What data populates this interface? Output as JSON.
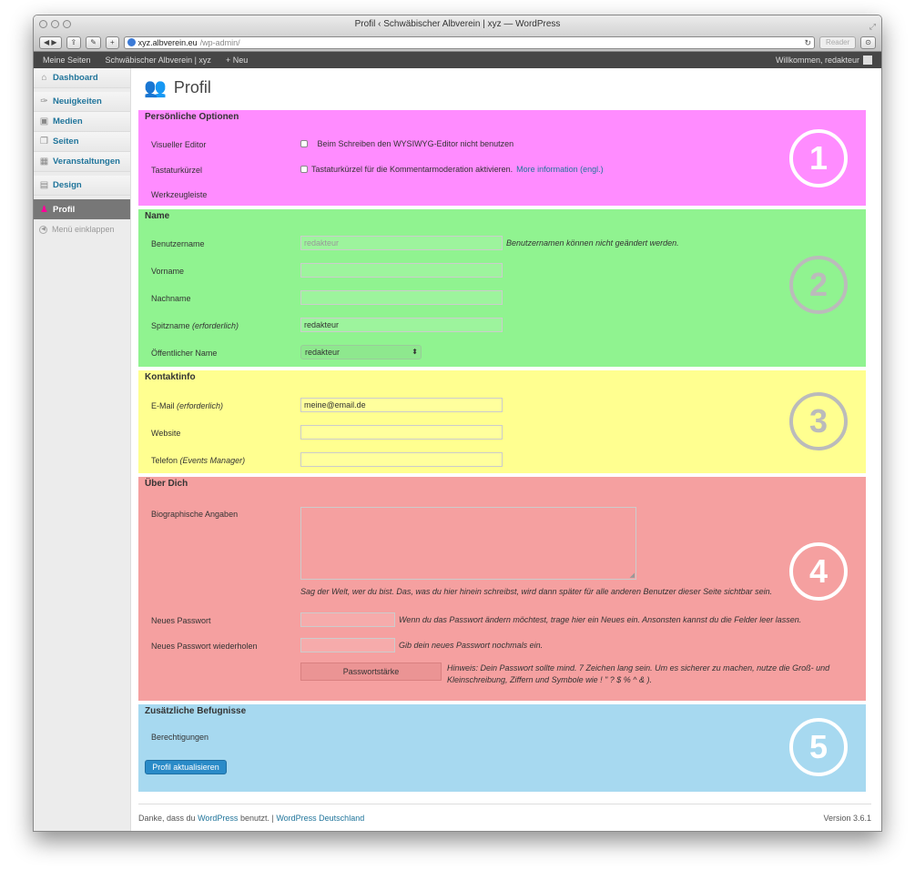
{
  "window": {
    "title": "Profil ‹ Schwäbischer Albverein | xyz — WordPress"
  },
  "browser": {
    "url_domain": "xyz.albverein.eu",
    "url_path": "/wp-admin/",
    "reader": "Reader"
  },
  "adminbar": {
    "my_sites": "Meine Seiten",
    "site": "Schwäbischer Albverein | xyz",
    "new": "Neu",
    "welcome": "Willkommen, redakteur"
  },
  "menu": {
    "items": [
      "Dashboard",
      "Neuigkeiten",
      "Medien",
      "Seiten",
      "Veranstaltungen",
      "Design",
      "Profil"
    ],
    "collapse": "Menü einklappen"
  },
  "page": {
    "title": "Profil"
  },
  "personal": {
    "heading": "Persönliche Optionen",
    "visual_editor": "Visueller Editor",
    "visual_editor_opt": "Beim Schreiben den WYSIWYG-Editor nicht benutzen",
    "shortcuts": "Tastaturkürzel",
    "shortcuts_opt": "Tastaturkürzel für die Kommentarmoderation aktivieren.",
    "more_info": "More information (engl.)",
    "toolbar": "Werkzeugleiste",
    "number": "1",
    "color": "#ff8cff"
  },
  "name": {
    "heading": "Name",
    "username": "Benutzername",
    "username_value": "redakteur",
    "username_hint": "Benutzernamen können nicht geändert werden.",
    "firstname": "Vorname",
    "lastname": "Nachname",
    "nickname": "Spitzname",
    "required": "(erforderlich)",
    "nickname_value": "redakteur",
    "display": "Öffentlicher Name",
    "display_value": "redakteur",
    "number": "2",
    "color": "#90f390"
  },
  "contact": {
    "heading": "Kontaktinfo",
    "email": "E-Mail",
    "required": "(erforderlich)",
    "email_value": "meine@email.de",
    "website": "Website",
    "phone": "Telefon",
    "phone_note": "(Events Manager)",
    "number": "3",
    "color": "#ffff90"
  },
  "about": {
    "heading": "Über Dich",
    "bio": "Biographische Angaben",
    "bio_hint": "Sag der Welt, wer du bist. Das, was du hier hinein schreibst, wird dann später für alle anderen Benutzer dieser Seite sichtbar sein.",
    "new_pw": "Neues Passwort",
    "new_pw_hint": "Wenn du das Passwort ändern möchtest, trage hier ein Neues ein. Ansonsten kannst du die Felder leer lassen.",
    "repeat_pw": "Neues Passwort wiederholen",
    "repeat_pw_hint": "Gib dein neues Passwort nochmals ein.",
    "strength": "Passwortstärke",
    "strength_hint_1": "Hinweis: Dein Passwort sollte mind. 7 Zeichen lang sein. Um es sicherer zu machen, nutze die Groß- und",
    "strength_hint_2": "Kleinschreibung, Ziffern und Symbole wie ! \" ? $ % ^ & ).",
    "number": "4",
    "color": "#f5a0a0"
  },
  "extra": {
    "heading": "Zusätzliche Befugnisse",
    "permissions": "Berechtigungen",
    "submit": "Profil aktualisieren",
    "number": "5",
    "color": "#a7d9f0"
  },
  "footer": {
    "thanks_pre": "Danke, dass du",
    "wordpress": "WordPress",
    "thanks_post": "benutzt. |",
    "wp_de": "WordPress Deutschland",
    "version": "Version 3.6.1"
  }
}
